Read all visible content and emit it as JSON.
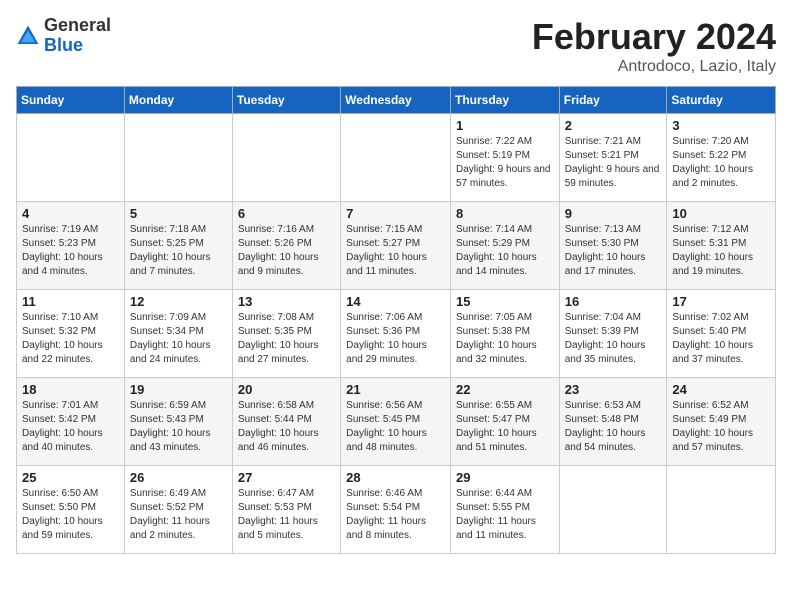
{
  "logo": {
    "general": "General",
    "blue": "Blue"
  },
  "title": "February 2024",
  "location": "Antrodoco, Lazio, Italy",
  "days_header": [
    "Sunday",
    "Monday",
    "Tuesday",
    "Wednesday",
    "Thursday",
    "Friday",
    "Saturday"
  ],
  "weeks": [
    [
      {
        "day": "",
        "sunrise": "",
        "sunset": "",
        "daylight": ""
      },
      {
        "day": "",
        "sunrise": "",
        "sunset": "",
        "daylight": ""
      },
      {
        "day": "",
        "sunrise": "",
        "sunset": "",
        "daylight": ""
      },
      {
        "day": "",
        "sunrise": "",
        "sunset": "",
        "daylight": ""
      },
      {
        "day": "1",
        "sunrise": "Sunrise: 7:22 AM",
        "sunset": "Sunset: 5:19 PM",
        "daylight": "Daylight: 9 hours and 57 minutes."
      },
      {
        "day": "2",
        "sunrise": "Sunrise: 7:21 AM",
        "sunset": "Sunset: 5:21 PM",
        "daylight": "Daylight: 9 hours and 59 minutes."
      },
      {
        "day": "3",
        "sunrise": "Sunrise: 7:20 AM",
        "sunset": "Sunset: 5:22 PM",
        "daylight": "Daylight: 10 hours and 2 minutes."
      }
    ],
    [
      {
        "day": "4",
        "sunrise": "Sunrise: 7:19 AM",
        "sunset": "Sunset: 5:23 PM",
        "daylight": "Daylight: 10 hours and 4 minutes."
      },
      {
        "day": "5",
        "sunrise": "Sunrise: 7:18 AM",
        "sunset": "Sunset: 5:25 PM",
        "daylight": "Daylight: 10 hours and 7 minutes."
      },
      {
        "day": "6",
        "sunrise": "Sunrise: 7:16 AM",
        "sunset": "Sunset: 5:26 PM",
        "daylight": "Daylight: 10 hours and 9 minutes."
      },
      {
        "day": "7",
        "sunrise": "Sunrise: 7:15 AM",
        "sunset": "Sunset: 5:27 PM",
        "daylight": "Daylight: 10 hours and 11 minutes."
      },
      {
        "day": "8",
        "sunrise": "Sunrise: 7:14 AM",
        "sunset": "Sunset: 5:29 PM",
        "daylight": "Daylight: 10 hours and 14 minutes."
      },
      {
        "day": "9",
        "sunrise": "Sunrise: 7:13 AM",
        "sunset": "Sunset: 5:30 PM",
        "daylight": "Daylight: 10 hours and 17 minutes."
      },
      {
        "day": "10",
        "sunrise": "Sunrise: 7:12 AM",
        "sunset": "Sunset: 5:31 PM",
        "daylight": "Daylight: 10 hours and 19 minutes."
      }
    ],
    [
      {
        "day": "11",
        "sunrise": "Sunrise: 7:10 AM",
        "sunset": "Sunset: 5:32 PM",
        "daylight": "Daylight: 10 hours and 22 minutes."
      },
      {
        "day": "12",
        "sunrise": "Sunrise: 7:09 AM",
        "sunset": "Sunset: 5:34 PM",
        "daylight": "Daylight: 10 hours and 24 minutes."
      },
      {
        "day": "13",
        "sunrise": "Sunrise: 7:08 AM",
        "sunset": "Sunset: 5:35 PM",
        "daylight": "Daylight: 10 hours and 27 minutes."
      },
      {
        "day": "14",
        "sunrise": "Sunrise: 7:06 AM",
        "sunset": "Sunset: 5:36 PM",
        "daylight": "Daylight: 10 hours and 29 minutes."
      },
      {
        "day": "15",
        "sunrise": "Sunrise: 7:05 AM",
        "sunset": "Sunset: 5:38 PM",
        "daylight": "Daylight: 10 hours and 32 minutes."
      },
      {
        "day": "16",
        "sunrise": "Sunrise: 7:04 AM",
        "sunset": "Sunset: 5:39 PM",
        "daylight": "Daylight: 10 hours and 35 minutes."
      },
      {
        "day": "17",
        "sunrise": "Sunrise: 7:02 AM",
        "sunset": "Sunset: 5:40 PM",
        "daylight": "Daylight: 10 hours and 37 minutes."
      }
    ],
    [
      {
        "day": "18",
        "sunrise": "Sunrise: 7:01 AM",
        "sunset": "Sunset: 5:42 PM",
        "daylight": "Daylight: 10 hours and 40 minutes."
      },
      {
        "day": "19",
        "sunrise": "Sunrise: 6:59 AM",
        "sunset": "Sunset: 5:43 PM",
        "daylight": "Daylight: 10 hours and 43 minutes."
      },
      {
        "day": "20",
        "sunrise": "Sunrise: 6:58 AM",
        "sunset": "Sunset: 5:44 PM",
        "daylight": "Daylight: 10 hours and 46 minutes."
      },
      {
        "day": "21",
        "sunrise": "Sunrise: 6:56 AM",
        "sunset": "Sunset: 5:45 PM",
        "daylight": "Daylight: 10 hours and 48 minutes."
      },
      {
        "day": "22",
        "sunrise": "Sunrise: 6:55 AM",
        "sunset": "Sunset: 5:47 PM",
        "daylight": "Daylight: 10 hours and 51 minutes."
      },
      {
        "day": "23",
        "sunrise": "Sunrise: 6:53 AM",
        "sunset": "Sunset: 5:48 PM",
        "daylight": "Daylight: 10 hours and 54 minutes."
      },
      {
        "day": "24",
        "sunrise": "Sunrise: 6:52 AM",
        "sunset": "Sunset: 5:49 PM",
        "daylight": "Daylight: 10 hours and 57 minutes."
      }
    ],
    [
      {
        "day": "25",
        "sunrise": "Sunrise: 6:50 AM",
        "sunset": "Sunset: 5:50 PM",
        "daylight": "Daylight: 10 hours and 59 minutes."
      },
      {
        "day": "26",
        "sunrise": "Sunrise: 6:49 AM",
        "sunset": "Sunset: 5:52 PM",
        "daylight": "Daylight: 11 hours and 2 minutes."
      },
      {
        "day": "27",
        "sunrise": "Sunrise: 6:47 AM",
        "sunset": "Sunset: 5:53 PM",
        "daylight": "Daylight: 11 hours and 5 minutes."
      },
      {
        "day": "28",
        "sunrise": "Sunrise: 6:46 AM",
        "sunset": "Sunset: 5:54 PM",
        "daylight": "Daylight: 11 hours and 8 minutes."
      },
      {
        "day": "29",
        "sunrise": "Sunrise: 6:44 AM",
        "sunset": "Sunset: 5:55 PM",
        "daylight": "Daylight: 11 hours and 11 minutes."
      },
      {
        "day": "",
        "sunrise": "",
        "sunset": "",
        "daylight": ""
      },
      {
        "day": "",
        "sunrise": "",
        "sunset": "",
        "daylight": ""
      }
    ]
  ]
}
